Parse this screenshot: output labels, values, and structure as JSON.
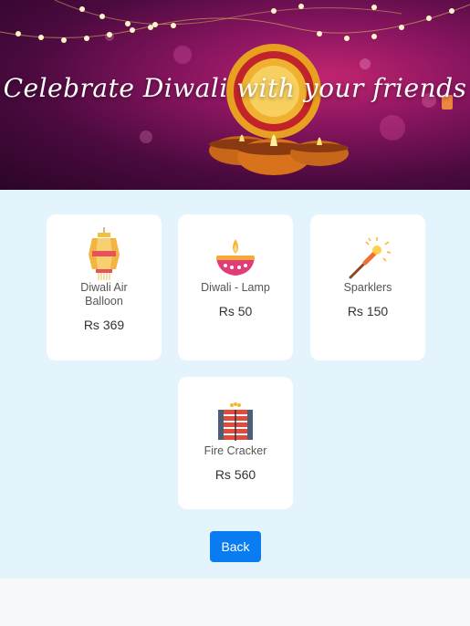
{
  "banner": {
    "title": "Celebrate Diwali with your friends"
  },
  "products": [
    {
      "name": "Diwali Air Balloon",
      "price": "Rs 369",
      "icon": "lantern-icon"
    },
    {
      "name": "Diwali - Lamp",
      "price": "Rs 50",
      "icon": "diya-lamp-icon"
    },
    {
      "name": "Sparklers",
      "price": "Rs 150",
      "icon": "sparkler-icon"
    },
    {
      "name": "Fire Cracker",
      "price": "Rs 560",
      "icon": "fire-cracker-icon"
    }
  ],
  "actions": {
    "back_label": "Back"
  },
  "colors": {
    "banner": "#6a0f4f",
    "content_bg": "#e3f4fd",
    "button": "#0a7cf2"
  }
}
